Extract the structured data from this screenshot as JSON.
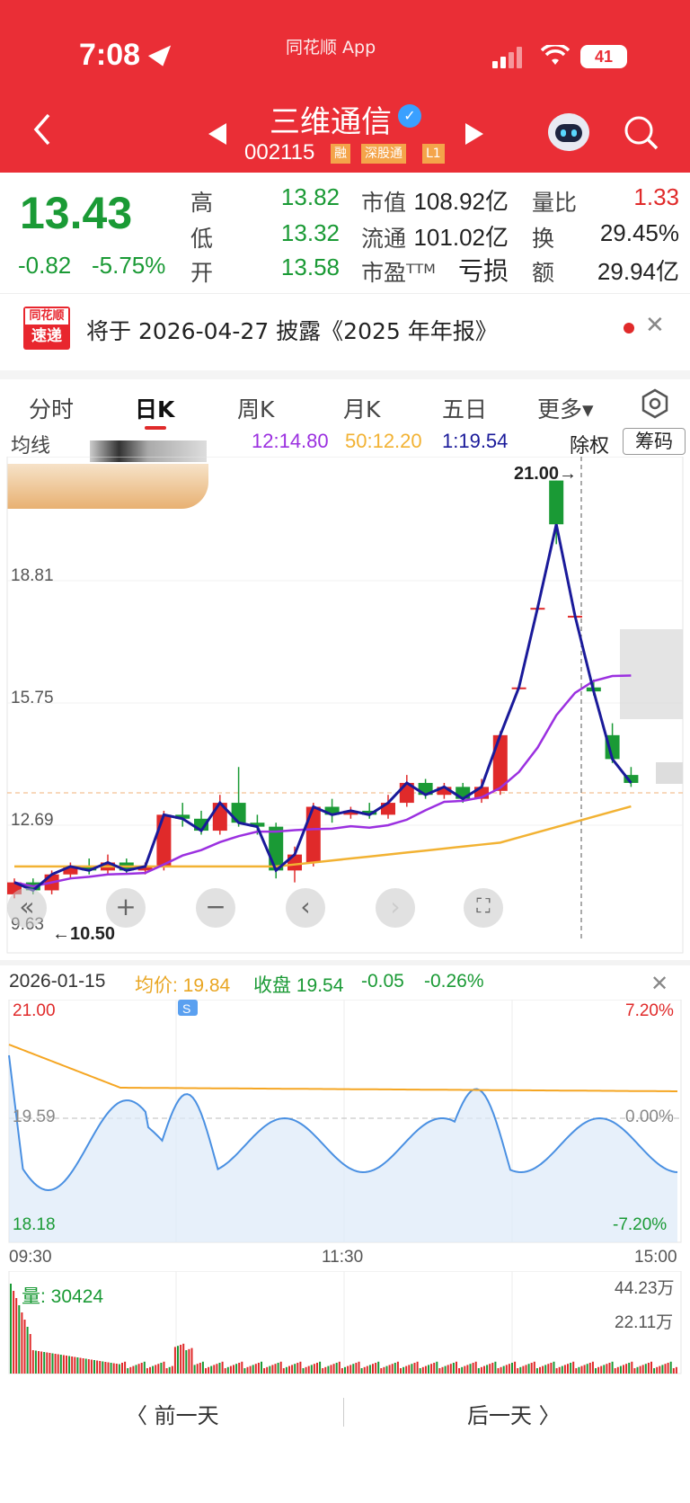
{
  "status": {
    "time": "7:08",
    "app_label": "同花顺 App",
    "battery": "41"
  },
  "header": {
    "name": "三维通信",
    "code": "002115",
    "tags": [
      "融",
      "深股通",
      "L1"
    ]
  },
  "quote": {
    "price": "13.43",
    "change": "-0.82",
    "change_pct": "-5.75%",
    "rows": [
      {
        "l1": "高",
        "v1": "13.82",
        "l2": "市值",
        "v2": "108.92亿",
        "l3": "量比",
        "v3": "1.33"
      },
      {
        "l1": "低",
        "v1": "13.32",
        "l2": "流通",
        "v2": "101.02亿",
        "l3": "换",
        "v3": "29.45%"
      },
      {
        "l1": "开",
        "v1": "13.58",
        "l2": "市盈ᵀᵀᴹ",
        "v2": "亏损",
        "l3": "额",
        "v3": "29.94亿"
      }
    ]
  },
  "notice": {
    "logo_top": "同花顺",
    "logo_bottom": "速递",
    "text": "将于 2026-04-27 披露《2025 年年报》"
  },
  "tabs": [
    "分时",
    "日K",
    "周K",
    "月K",
    "五日",
    "更多▾"
  ],
  "kline": {
    "ma_label": "均线",
    "ma12": "12:14.80",
    "ma50": "50:12.20",
    "ma1": "1:19.54",
    "btn_exright": "除权",
    "btn_chips": "筹码",
    "high_marker": "21.00→",
    "low_marker": "←10.50",
    "y_labels": [
      "18.81",
      "15.75",
      "12.69",
      "9.63"
    ]
  },
  "intraday": {
    "date": "2026-01-15",
    "avg_label": "均价: 19.84",
    "close_label": "收盘 19.54",
    "chg": "-0.05",
    "chg_pct": "-0.26%",
    "max": "21.00",
    "mid": "19.59",
    "min": "18.18",
    "pmax": "7.20%",
    "pmid": "0.00%",
    "pmin": "-7.20%",
    "t_start": "09:30",
    "t_mid": "11:30",
    "t_end": "15:00",
    "vol_label": "量: 30424",
    "vol_max": "44.23万",
    "vol_mid": "22.11万"
  },
  "footer": {
    "prev": "〈  前一天",
    "next": "后一天  〉"
  },
  "colors": {
    "brand": "#ea2e36",
    "down": "#1a9a35",
    "up": "#e02a2a",
    "ma1": "#1a1a9a",
    "ma12": "#9b30e0",
    "ma50": "#f2b233"
  }
}
